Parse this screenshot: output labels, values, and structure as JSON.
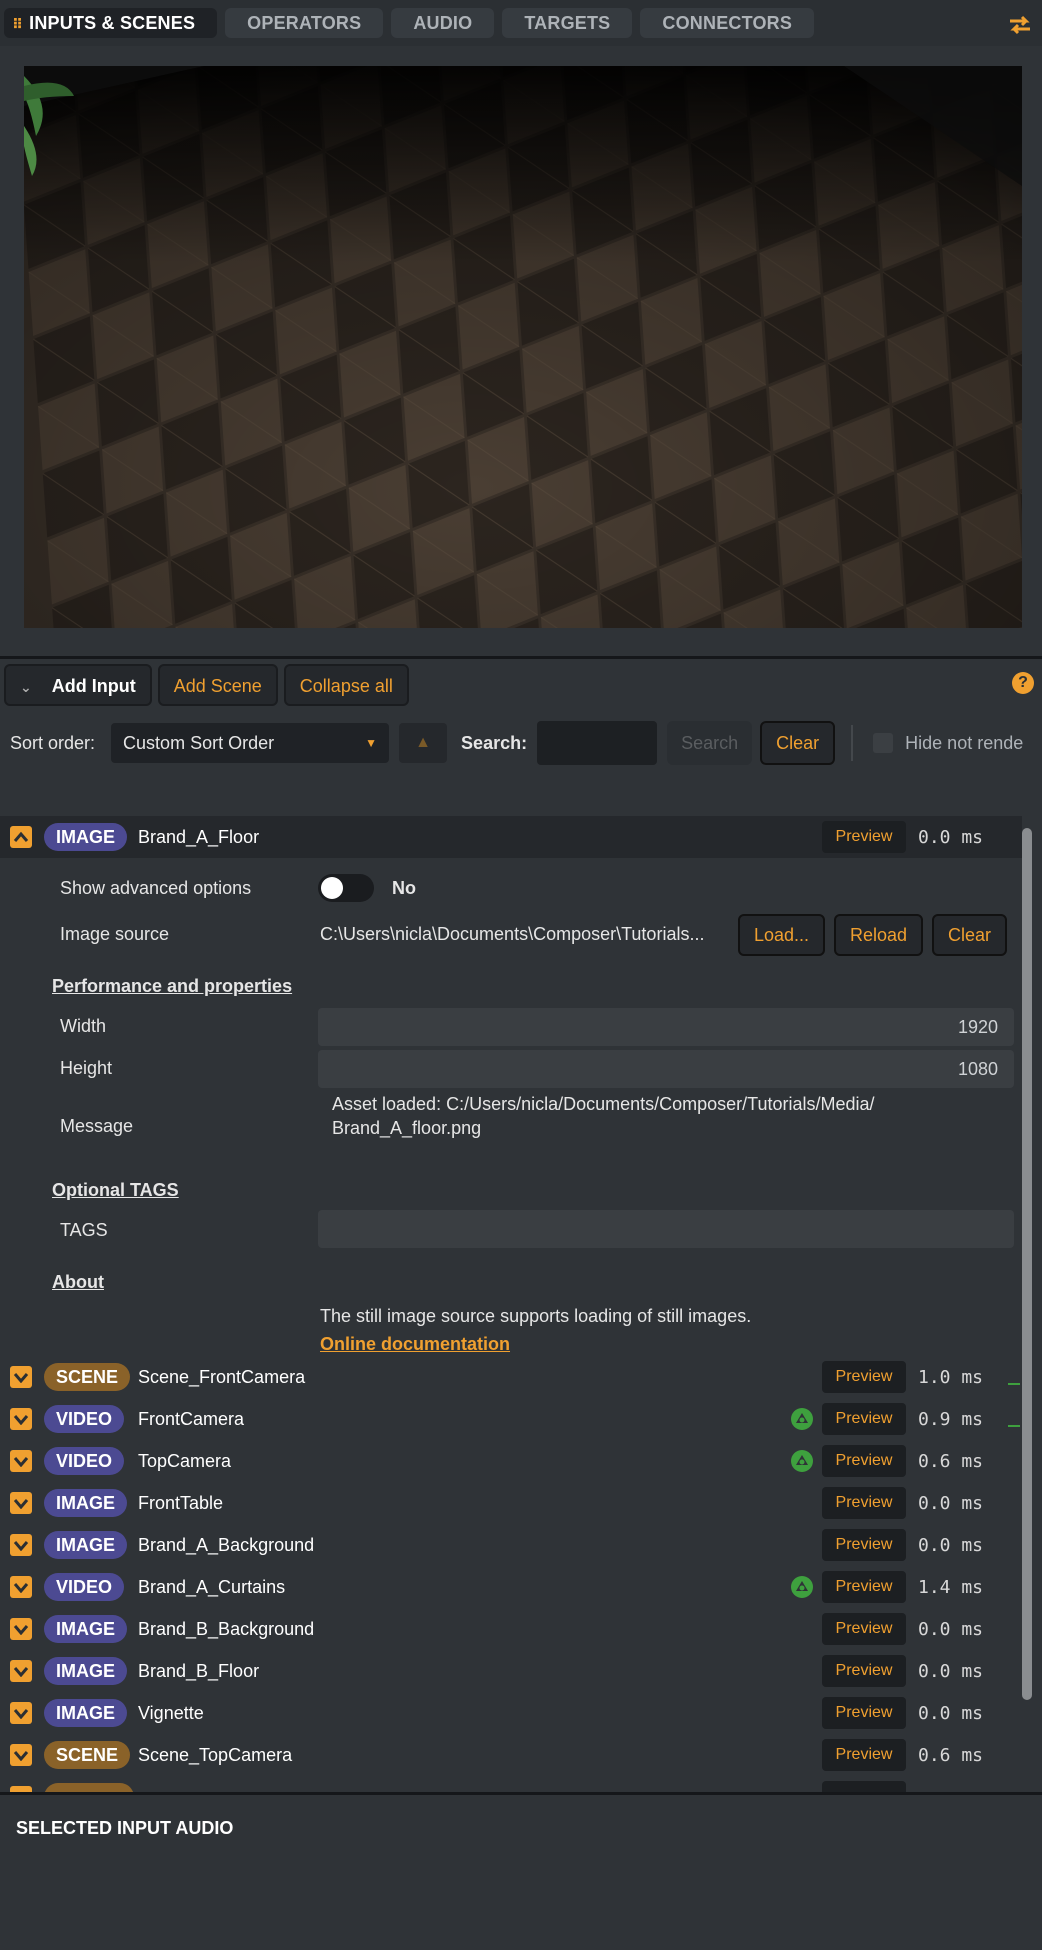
{
  "tabs": [
    {
      "label": "INPUTS & SCENES",
      "active": true
    },
    {
      "label": "OPERATORS"
    },
    {
      "label": "AUDIO"
    },
    {
      "label": "TARGETS"
    },
    {
      "label": "CONNECTORS"
    }
  ],
  "toolbar": {
    "add_input": "Add Input",
    "add_scene": "Add Scene",
    "collapse_all": "Collapse all",
    "help": "?"
  },
  "sort": {
    "label": "Sort order:",
    "value": "Custom Sort Order",
    "search_label": "Search:",
    "search_value": "",
    "search_button": "Search",
    "clear_button": "Clear",
    "hide_label": "Hide not rende"
  },
  "expanded": {
    "type": "IMAGE",
    "name": "Brand_A_Floor",
    "preview": "Preview",
    "ms": "0.0 ms",
    "advanced_label": "Show advanced options",
    "advanced_value": "No",
    "source_label": "Image source",
    "source_value": "C:\\Users\\nicla\\Documents\\Composer\\Tutorials...",
    "load": "Load...",
    "reload": "Reload",
    "clear": "Clear",
    "perf_title": "Performance and properties",
    "width_label": "Width",
    "width_value": "1920",
    "height_label": "Height",
    "height_value": "1080",
    "message_label": "Message",
    "message_line1": "Asset loaded: C:/Users/nicla/Documents/Composer/Tutorials/Media/",
    "message_line2": "Brand_A_floor.png",
    "tags_title": "Optional TAGS",
    "tags_label": "TAGS",
    "tags_value": "",
    "about_title": "About",
    "about_text": "The still image source supports loading of still images.",
    "doc_link": "Online documentation"
  },
  "rows": [
    {
      "type": "SCENE",
      "name": "Scene_FrontCamera",
      "preview": "Preview",
      "ms": "1.0 ms",
      "ndi": false,
      "activity": true
    },
    {
      "type": "VIDEO",
      "name": "FrontCamera",
      "preview": "Preview",
      "ms": "0.9 ms",
      "ndi": true,
      "activity": true
    },
    {
      "type": "VIDEO",
      "name": "TopCamera",
      "preview": "Preview",
      "ms": "0.6 ms",
      "ndi": true
    },
    {
      "type": "IMAGE",
      "name": "FrontTable",
      "preview": "Preview",
      "ms": "0.0 ms"
    },
    {
      "type": "IMAGE",
      "name": "Brand_A_Background",
      "preview": "Preview",
      "ms": "0.0 ms"
    },
    {
      "type": "VIDEO",
      "name": "Brand_A_Curtains",
      "preview": "Preview",
      "ms": "1.4 ms",
      "ndi": true
    },
    {
      "type": "IMAGE",
      "name": "Brand_B_Background",
      "preview": "Preview",
      "ms": "0.0 ms"
    },
    {
      "type": "IMAGE",
      "name": "Brand_B_Floor",
      "preview": "Preview",
      "ms": "0.0 ms"
    },
    {
      "type": "IMAGE",
      "name": "Vignette",
      "preview": "Preview",
      "ms": "0.0 ms"
    },
    {
      "type": "SCENE",
      "name": "Scene_TopCamera",
      "preview": "Preview",
      "ms": "0.6 ms"
    }
  ],
  "audio": {
    "title": "SELECTED INPUT AUDIO"
  },
  "colors": {
    "accent": "#f0a030",
    "tag_image": "#4c4a92",
    "tag_scene": "#8a6229",
    "ndi": "#3ea03e"
  }
}
